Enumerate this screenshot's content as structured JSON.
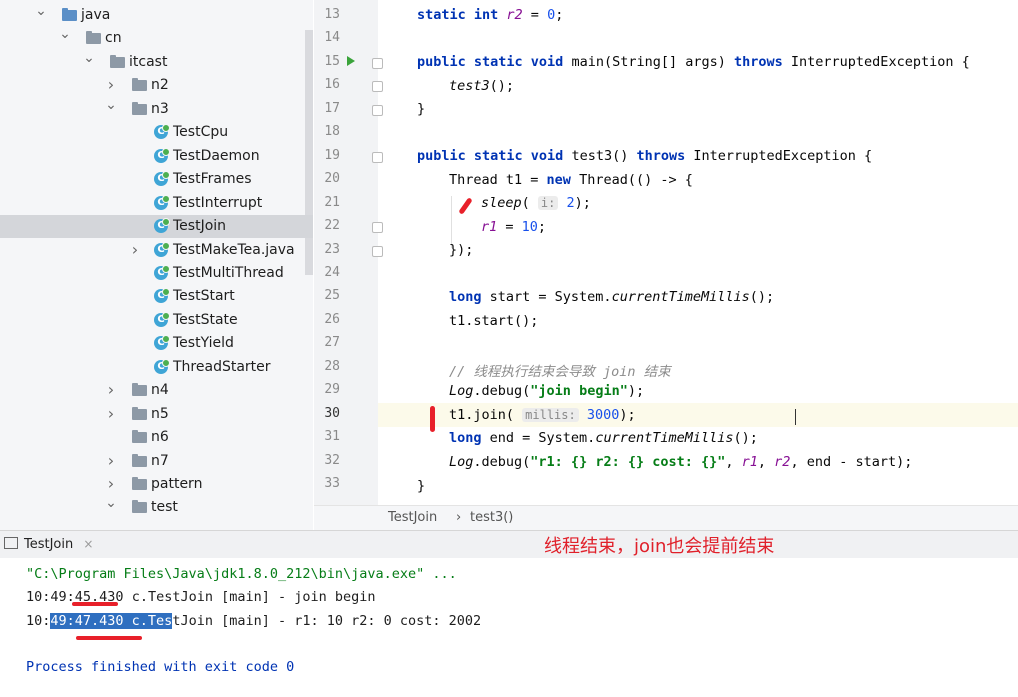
{
  "project_tree": {
    "items": [
      {
        "label": "java",
        "type": "folder-java",
        "expanded": true
      },
      {
        "label": "cn",
        "type": "folder",
        "expanded": true
      },
      {
        "label": "itcast",
        "type": "folder",
        "expanded": true
      },
      {
        "label": "n2",
        "type": "folder",
        "expanded": false
      },
      {
        "label": "n3",
        "type": "folder",
        "expanded": true
      },
      {
        "label": "TestCpu",
        "type": "class"
      },
      {
        "label": "TestDaemon",
        "type": "class"
      },
      {
        "label": "TestFrames",
        "type": "class"
      },
      {
        "label": "TestInterrupt",
        "type": "class"
      },
      {
        "label": "TestJoin",
        "type": "class",
        "selected": true
      },
      {
        "label": "TestMakeTea.java",
        "type": "class",
        "expandable": true
      },
      {
        "label": "TestMultiThread",
        "type": "class"
      },
      {
        "label": "TestStart",
        "type": "class"
      },
      {
        "label": "TestState",
        "type": "class"
      },
      {
        "label": "TestYield",
        "type": "class"
      },
      {
        "label": "ThreadStarter",
        "type": "class"
      },
      {
        "label": "n4",
        "type": "folder",
        "expanded": false
      },
      {
        "label": "n5",
        "type": "folder",
        "expanded": false
      },
      {
        "label": "n6",
        "type": "folder",
        "leaf": true
      },
      {
        "label": "n7",
        "type": "folder",
        "expanded": false
      },
      {
        "label": "pattern",
        "type": "folder",
        "expanded": false
      },
      {
        "label": "test",
        "type": "folder",
        "expanded": true
      }
    ]
  },
  "editor": {
    "line_numbers": [
      "13",
      "14",
      "15",
      "16",
      "17",
      "18",
      "19",
      "20",
      "21",
      "22",
      "23",
      "24",
      "25",
      "26",
      "27",
      "28",
      "29",
      "30",
      "31",
      "32",
      "33"
    ],
    "code": {
      "l13_kw": "static int ",
      "l13_fld": "r2",
      "l13_rest": " = ",
      "l13_num": "0",
      "l13_end": ";",
      "l15_kw": "public static void ",
      "l15_a": "main(String[] args) ",
      "l15_kw2": "throws ",
      "l15_b": "InterruptedException {",
      "l16_it": "test3",
      "l16_rest": "();",
      "l17": "}",
      "l19_kw": "public static void ",
      "l19_a": "test3() ",
      "l19_kw2": "throws ",
      "l19_b": "InterruptedException {",
      "l20_a": "Thread t1 = ",
      "l20_kw": "new ",
      "l20_b": "Thread(() -> {",
      "l21_it": "sleep",
      "l21_a": "( ",
      "l21_hint": "i:",
      "l21_num": " 2",
      "l21_b": ");",
      "l22_fld": "r1",
      "l22_a": " = ",
      "l22_num": "10",
      "l22_b": ";",
      "l23": "});",
      "l25_kw": "long ",
      "l25_a": "start = System.",
      "l25_it": "currentTimeMillis",
      "l25_b": "();",
      "l26": "t1.start();",
      "l28_cmt": "// 线程执行结束会导致 join 结束",
      "l29_it": "Log",
      "l29_a": ".debug(",
      "l29_str": "\"join begin\"",
      "l29_b": ");",
      "l30_a": "t1.join( ",
      "l30_hint": "millis:",
      "l30_num": " 3000",
      "l30_b": ");",
      "l31_kw": "long ",
      "l31_a": "end = System.",
      "l31_it": "currentTimeMillis",
      "l31_b": "();",
      "l32_it": "Log",
      "l32_a": ".debug(",
      "l32_str": "\"r1: {} r2: {} cost: {}\"",
      "l32_b": ", ",
      "l32_f1": "r1",
      "l32_c": ", ",
      "l32_f2": "r2",
      "l32_d": ", end - start);",
      "l33": "}"
    }
  },
  "breadcrumb": {
    "class": "TestJoin",
    "sep": "›",
    "method": "test3()"
  },
  "console": {
    "tab_label": "TestJoin",
    "tab_close": "×",
    "cmd": "\"C:\\Program Files\\Java\\jdk1.8.0_212\\bin\\java.exe\" ...",
    "line1_a": "10:49:",
    "line1_b": "45.430",
    "line1_c": " c.TestJoin [main] - join begin",
    "line2_a": "10:",
    "line2_sel": "49:47.430 c.Tes",
    "line2_c": "tJoin [main] - r1: 10 r2: 0 cost: 2002",
    "finished": "Process finished with exit code 0"
  },
  "annotation": "线程结束，join也会提前结束",
  "colors": {
    "keyword": "#0033b3",
    "string": "#067d17",
    "number": "#1750eb",
    "field": "#871094",
    "annotation": "#e0202a",
    "selection": "#2f6fc0"
  }
}
